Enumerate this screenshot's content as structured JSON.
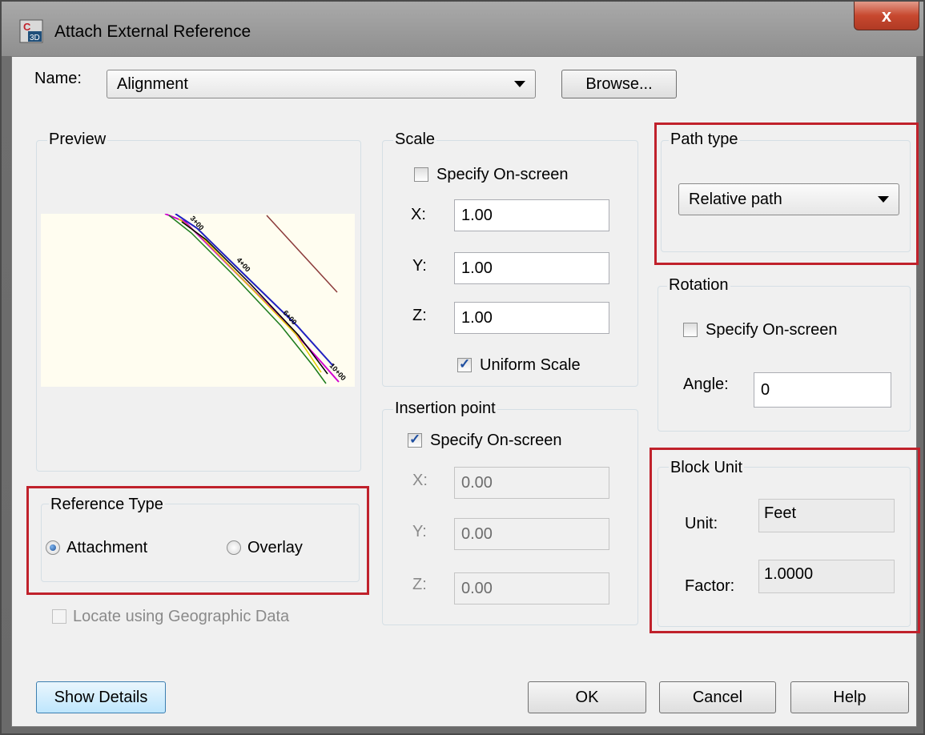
{
  "window": {
    "title": "Attach External Reference",
    "close_label": "x"
  },
  "name": {
    "label": "Name:",
    "value": "Alignment",
    "browse_label": "Browse..."
  },
  "preview": {
    "label": "Preview",
    "station_labels": [
      "3+00",
      "4+00",
      "6+00",
      "10+00"
    ]
  },
  "scale": {
    "label": "Scale",
    "specify_on_screen": {
      "label": "Specify On-screen",
      "checked": false
    },
    "x": {
      "label": "X:",
      "value": "1.00"
    },
    "y": {
      "label": "Y:",
      "value": "1.00"
    },
    "z": {
      "label": "Z:",
      "value": "1.00"
    },
    "uniform_scale": {
      "label": "Uniform Scale",
      "checked": true
    }
  },
  "path_type": {
    "label": "Path type",
    "value": "Relative path"
  },
  "rotation": {
    "label": "Rotation",
    "specify_on_screen": {
      "label": "Specify On-screen",
      "checked": false
    },
    "angle": {
      "label": "Angle:",
      "value": "0"
    }
  },
  "insertion_point": {
    "label": "Insertion point",
    "specify_on_screen": {
      "label": "Specify On-screen",
      "checked": true
    },
    "x": {
      "label": "X:",
      "value": "0.00"
    },
    "y": {
      "label": "Y:",
      "value": "0.00"
    },
    "z": {
      "label": "Z:",
      "value": "0.00"
    }
  },
  "reference_type": {
    "label": "Reference Type",
    "attachment": {
      "label": "Attachment",
      "selected": true
    },
    "overlay": {
      "label": "Overlay",
      "selected": false
    }
  },
  "geographic": {
    "label": "Locate using Geographic Data",
    "checked": false
  },
  "block_unit": {
    "label": "Block Unit",
    "unit": {
      "label": "Unit:",
      "value": "Feet"
    },
    "factor": {
      "label": "Factor:",
      "value": "1.0000"
    }
  },
  "buttons": {
    "show_details": "Show Details",
    "ok": "OK",
    "cancel": "Cancel",
    "help": "Help"
  },
  "colors": {
    "highlight_box": "#c0212b",
    "accent": "#3c7fb1"
  },
  "icons": {
    "app": "civil-3d-icon",
    "close": "close-icon",
    "dropdown": "chevron-down-icon"
  }
}
